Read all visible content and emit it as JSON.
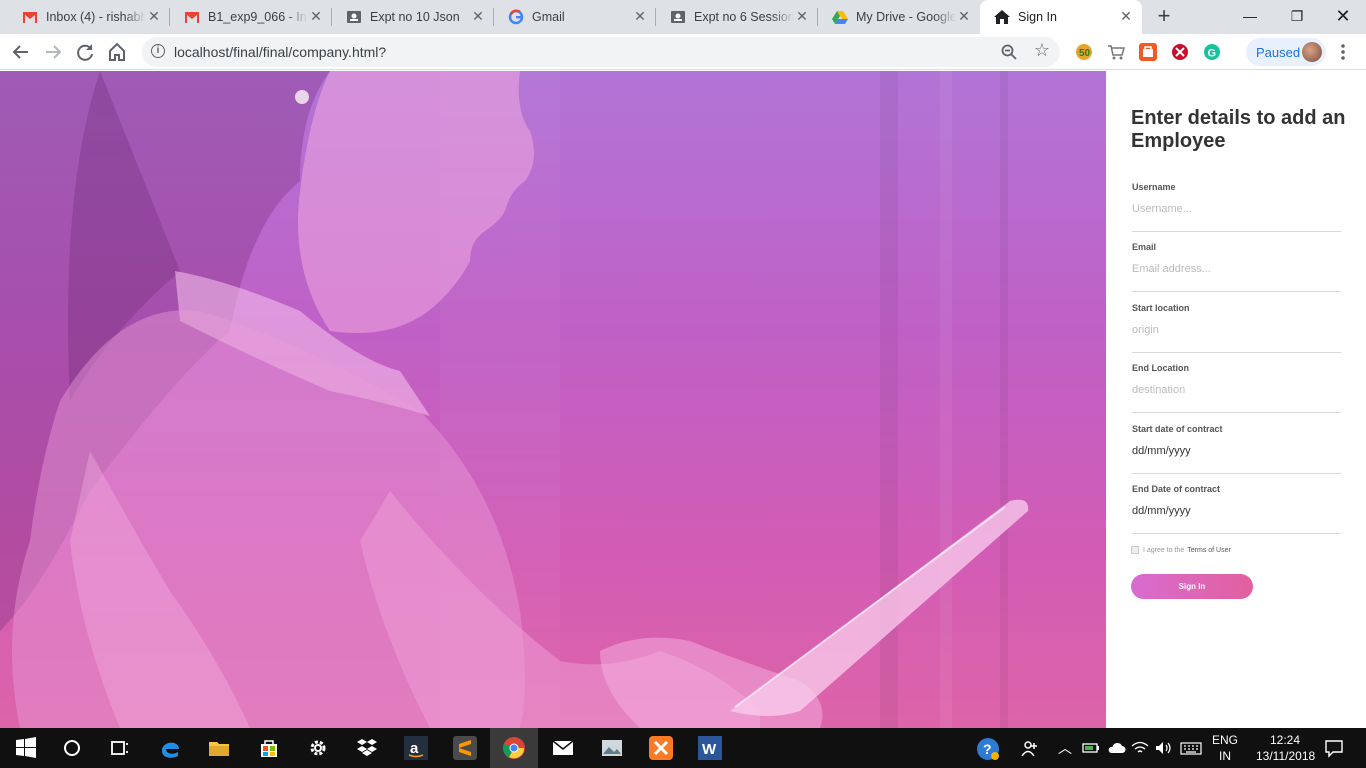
{
  "browser": {
    "tabs": [
      {
        "title": "Inbox (4) - rishabh",
        "icon": "gmail-icon"
      },
      {
        "title": "B1_exp9_066 - Invi",
        "icon": "gmail-icon"
      },
      {
        "title": "Expt no 10 Json",
        "icon": "classroom-icon"
      },
      {
        "title": "Gmail",
        "icon": "google-icon"
      },
      {
        "title": "Expt no 6 Session",
        "icon": "classroom-icon"
      },
      {
        "title": "My Drive - Google",
        "icon": "drive-icon"
      },
      {
        "title": "Sign In",
        "icon": "home-icon",
        "active": true
      }
    ],
    "url": "localhost/final/final/company.html?",
    "profile_status": "Paused"
  },
  "form": {
    "title": "Enter details to add an Employee",
    "fields": [
      {
        "label": "Username",
        "placeholder": "Username...",
        "value": ""
      },
      {
        "label": "Email",
        "placeholder": "Email address...",
        "value": ""
      },
      {
        "label": "Start location",
        "placeholder": "origin",
        "value": ""
      },
      {
        "label": "End Location",
        "placeholder": "destination",
        "value": ""
      },
      {
        "label": "Start date of contract",
        "placeholder": "",
        "value": "dd/mm/yyyy"
      },
      {
        "label": "End Date of contract",
        "placeholder": "",
        "value": "dd/mm/yyyy"
      }
    ],
    "terms_prefix": "I agree to the",
    "terms_link": "Terms of User",
    "submit_label": "Sign In"
  },
  "taskbar": {
    "language": "ENG",
    "region": "IN",
    "time": "12:24",
    "date": "13/11/2018"
  },
  "colors": {
    "hero_top": "#b274d6",
    "hero_bottom": "#dd64a8",
    "button_start": "#d86cd0",
    "button_end": "#e2609e"
  }
}
